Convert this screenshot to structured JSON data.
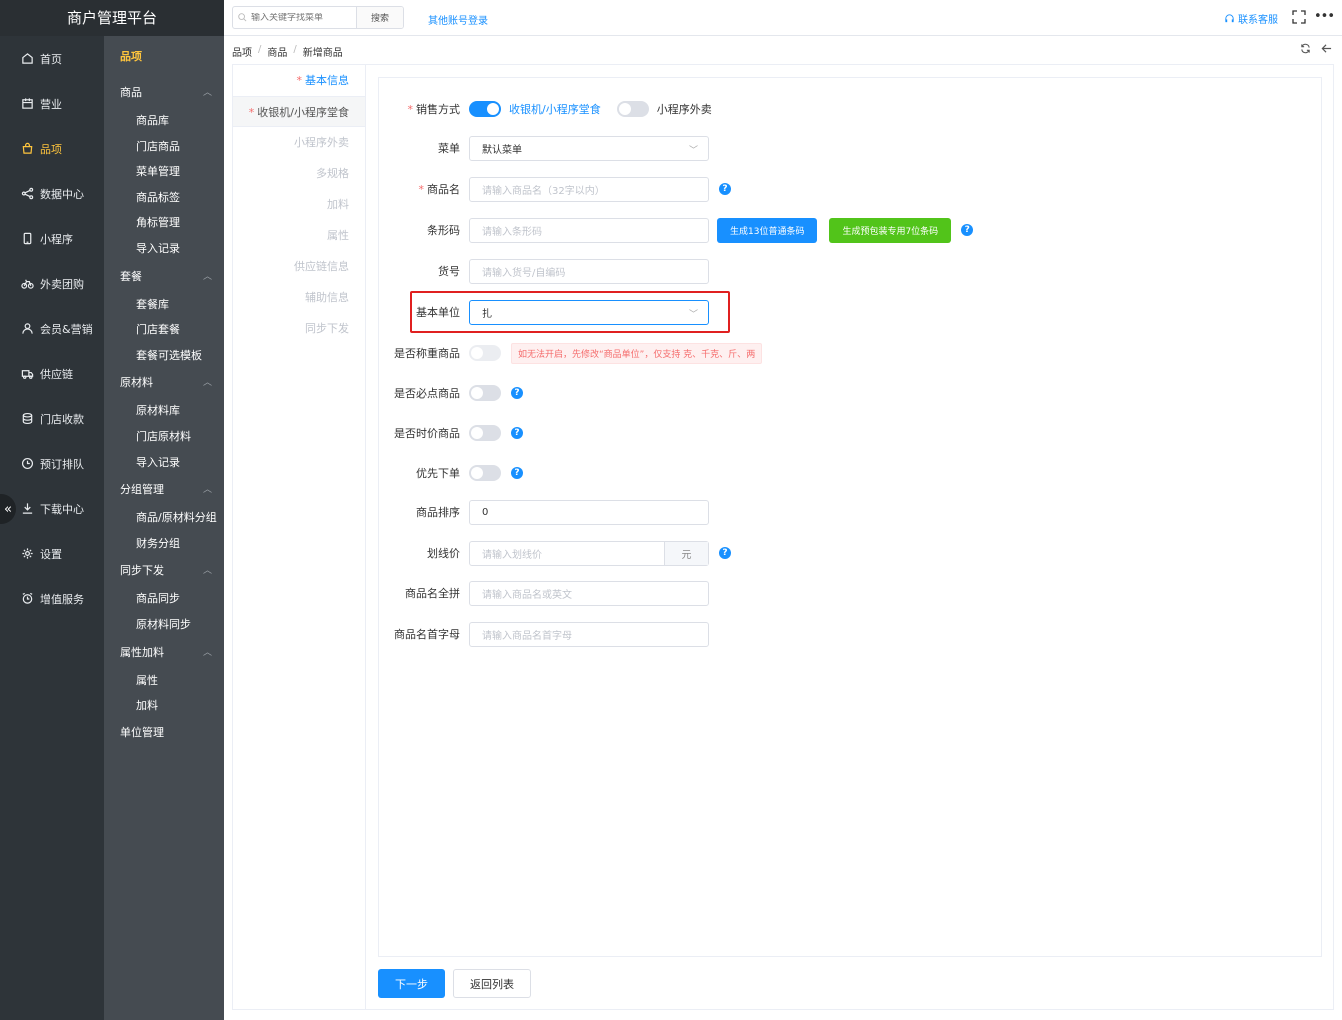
{
  "app": {
    "title": "商户管理平台"
  },
  "primary_nav": [
    {
      "label": "首页",
      "icon": "home-icon"
    },
    {
      "label": "营业",
      "icon": "calendar-icon"
    },
    {
      "label": "品项",
      "icon": "bag-icon",
      "active": true
    },
    {
      "label": "数据中心",
      "icon": "share-icon"
    },
    {
      "label": "小程序",
      "icon": "phone-icon"
    },
    {
      "label": "外卖团购",
      "icon": "bike-icon"
    },
    {
      "label": "会员&营销",
      "icon": "user-icon"
    },
    {
      "label": "供应链",
      "icon": "truck-icon"
    },
    {
      "label": "门店收款",
      "icon": "database-icon"
    },
    {
      "label": "预订排队",
      "icon": "clock-icon"
    },
    {
      "label": "下载中心",
      "icon": "download-icon"
    },
    {
      "label": "设置",
      "icon": "gear-icon"
    },
    {
      "label": "增值服务",
      "icon": "alarm-icon"
    }
  ],
  "secondary_nav": {
    "title": "品项",
    "groups": [
      {
        "label": "商品",
        "items": [
          "商品库",
          "门店商品",
          "菜单管理",
          "商品标签",
          "角标管理",
          "导入记录"
        ]
      },
      {
        "label": "套餐",
        "items": [
          "套餐库",
          "门店套餐",
          "套餐可选模板"
        ]
      },
      {
        "label": "原材料",
        "items": [
          "原材料库",
          "门店原材料",
          "导入记录"
        ]
      },
      {
        "label": "分组管理",
        "items": [
          "商品/原材料分组",
          "财务分组"
        ]
      },
      {
        "label": "同步下发",
        "items": [
          "商品同步",
          "原材料同步"
        ]
      },
      {
        "label": "属性加料",
        "items": [
          "属性",
          "加料"
        ]
      }
    ],
    "solo": "单位管理"
  },
  "topbar": {
    "search_placeholder": "输入关键字找菜单",
    "search_button": "搜索",
    "other_login": "其他账号登录",
    "contact": "联系客服",
    "more": "•••"
  },
  "breadcrumb": [
    "品项",
    "商品",
    "新增商品"
  ],
  "steps": [
    {
      "label": "基本信息",
      "star": "*",
      "state": "active"
    },
    {
      "label": "收银机/小程序堂食",
      "star": "*",
      "state": "req"
    },
    {
      "label": "小程序外卖"
    },
    {
      "label": "多规格"
    },
    {
      "label": "加料"
    },
    {
      "label": "属性"
    },
    {
      "label": "供应链信息"
    },
    {
      "label": "辅助信息"
    },
    {
      "label": "同步下发"
    }
  ],
  "form": {
    "sale_mode": {
      "label": "销售方式",
      "opt1": "收银机/小程序堂食",
      "opt2": "小程序外卖"
    },
    "menu": {
      "label": "菜单",
      "value": "默认菜单"
    },
    "name": {
      "label": "商品名",
      "placeholder": "请输入商品名（32字以内）"
    },
    "barcode": {
      "label": "条形码",
      "placeholder": "请输入条形码",
      "btn13": "生成13位普通条码",
      "btn7": "生成预包装专用7位条码"
    },
    "sku": {
      "label": "货号",
      "placeholder": "请输入货号/自编码"
    },
    "unit": {
      "label": "基本单位",
      "value": "扎"
    },
    "weighed": {
      "label": "是否称重商品",
      "warning": "如无法开启，先修改“商品单位”，仅支持 克、千克、斤、两"
    },
    "required": {
      "label": "是否必点商品"
    },
    "timeprice": {
      "label": "是否时价商品"
    },
    "priority": {
      "label": "优先下单"
    },
    "sort": {
      "label": "商品排序",
      "value": "0"
    },
    "strike": {
      "label": "划线价",
      "placeholder": "请输入划线价",
      "suffix": "元"
    },
    "pinyin": {
      "label": "商品名全拼",
      "placeholder": "请输入商品名或英文"
    },
    "initials": {
      "label": "商品名首字母",
      "placeholder": "请输入商品名首字母"
    }
  },
  "footer": {
    "next": "下一步",
    "back": "返回列表"
  },
  "colors": {
    "primary": "#1890ff",
    "success": "#52c41a",
    "danger": "#f56c6c",
    "accent": "#ffc53d",
    "sidebar": "#2e3439"
  }
}
